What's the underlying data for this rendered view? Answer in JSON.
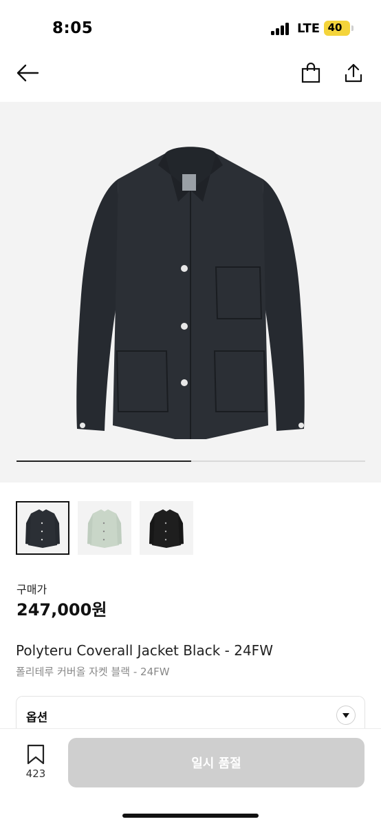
{
  "status_bar": {
    "time": "8:05",
    "network": "LTE",
    "battery": "40",
    "battery_color": "#f4d43b"
  },
  "header": {
    "back_icon": "arrow-left-icon",
    "bag_icon": "shopping-bag-icon",
    "share_icon": "share-icon"
  },
  "gallery": {
    "image_desc_icon": "jacket-image",
    "progress_fraction": 0.5,
    "thumbnails": [
      {
        "name": "thumb-black-jacket",
        "color": "#2b2f35",
        "active": true
      },
      {
        "name": "thumb-mint-jacket",
        "color": "#c9d6c8",
        "active": false
      },
      {
        "name": "thumb-dark-jacket",
        "color": "#1e1e1e",
        "active": false
      }
    ]
  },
  "product": {
    "price_label": "구매가",
    "price": "247,000원",
    "title_en": "Polyteru Coverall Jacket Black - 24FW",
    "title_ko": "폴리테루 커버올 자켓 블랙 - 24FW"
  },
  "options": {
    "label": "옵션",
    "arrow_icon": "chevron-down-icon"
  },
  "bottom_bar": {
    "wish_icon": "bookmark-icon",
    "wish_count": "423",
    "buy_label": "일시 품절",
    "buy_color": "#cfcfcf"
  }
}
